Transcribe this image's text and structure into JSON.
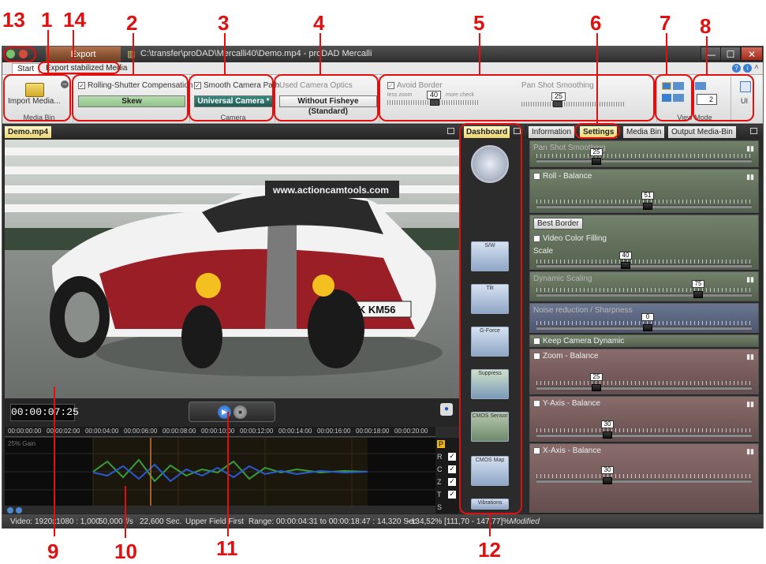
{
  "annotations": [
    "13",
    "1",
    "14",
    "2",
    "3",
    "4",
    "5",
    "6",
    "7",
    "8",
    "9",
    "10",
    "11",
    "12"
  ],
  "window": {
    "title": "C:\\transfer\\proDAD\\Mercalli40\\Demo.mp4 - proDAD Mercalli",
    "export_tab": "Export",
    "controls": {
      "minimize": "—",
      "maximize": "☐",
      "close": "✕"
    }
  },
  "menu": {
    "tabs": [
      "Start",
      "Export stabilized Media"
    ]
  },
  "ribbon": {
    "media_bin": {
      "button_label": "Import Media...",
      "group_label": "Media Bin"
    },
    "rolling_shutter": {
      "checkbox_label": "Rolling-Shutter Compensation",
      "combo_value": "Skew"
    },
    "camera": {
      "checkbox_label": "Smooth Camera Path",
      "combo_value": "Universal Camera *",
      "group_label": "Camera"
    },
    "optics": {
      "label": "Used Camera Optics",
      "combo_value": "Without Fisheye (Standard)"
    },
    "avoid_border": {
      "checkbox_label": "Avoid Border",
      "left_label": "less zoom",
      "right_label": "more check",
      "value": "40"
    },
    "pan_shot": {
      "label": "Pan Shot Smoothing",
      "value": "25"
    },
    "view_mode": {
      "group_label": "View Mode",
      "spin_value": "2",
      "ui_label": "UI"
    }
  },
  "viewer": {
    "file_tab": "Demo.mp4",
    "timecode": "00:00:07:25",
    "ruler_ticks": [
      "00:00:00:00",
      "00:00:02:00",
      "00:00:04:00",
      "00:00:06:00",
      "00:00:08:00",
      "00:00:10:00",
      "00:00:12:00",
      "00:00:14:00",
      "00:00:16:00",
      "00:00:18:00",
      "00:00:20:00"
    ],
    "graph_label": "25% Gain",
    "legend": [
      {
        "label": "P",
        "checked": false,
        "highlight": true
      },
      {
        "label": "R",
        "checked": true
      },
      {
        "label": "C",
        "checked": true
      },
      {
        "label": "Z",
        "checked": true
      },
      {
        "label": "T",
        "checked": true
      },
      {
        "label": "S",
        "checked": false
      }
    ],
    "sign_text": "www.actioncamtools.com",
    "plate_text": "MK KM56"
  },
  "dashboard": {
    "tab": "Dashboard",
    "widgets": [
      "",
      "S/W",
      "Tilt",
      "G-Force",
      "Suppress",
      "CMOS Sensor",
      "CMOS Map",
      "Vibrations"
    ]
  },
  "settings_panel": {
    "tabs": [
      "Information",
      "Settings",
      "Media Bin",
      "Output Media-Bin"
    ],
    "pan_shot": {
      "title": "Pan Shot Smoothing",
      "value": "25",
      "level": 0.25
    },
    "roll": {
      "title": "Roll - Balance",
      "value": "51",
      "level": 0.51
    },
    "border": {
      "combo": "Best Border",
      "checkbox": "Video Color Filling",
      "scale_label": "Scale",
      "value": "40",
      "level": 0.4
    },
    "dynamic_scaling": {
      "title": "Dynamic Scaling",
      "value": "75",
      "level": 0.75
    },
    "noise": {
      "title": "Noise reduction / Sharpness",
      "value": "0",
      "level": 0.5
    },
    "keep_dynamic": {
      "title": "Keep Camera Dynamic"
    },
    "zoom": {
      "title": "Zoom - Balance",
      "value": "25",
      "level": 0.25
    },
    "y_axis": {
      "title": "Y-Axis - Balance",
      "value": "30",
      "level": 0.3
    },
    "x_axis": {
      "title": "X-Axis - Balance",
      "value": "30",
      "level": 0.3
    }
  },
  "status_bar": {
    "video": "Video: 1920x1080 : 1,000",
    "fps": "50,000 f/s",
    "duration": "22,600 Sec.",
    "field": "Upper Field First",
    "range": "Range: 00:00:04:31 to 00:00:18:47 : 14,320 Sec.",
    "zoom": "~134,52% [111,70 - 147,77]%",
    "state": "Modified"
  },
  "colors": {
    "annotation": "#e01010",
    "accent_tab": "#ecd570",
    "export_tab": "#8b4a2a"
  }
}
